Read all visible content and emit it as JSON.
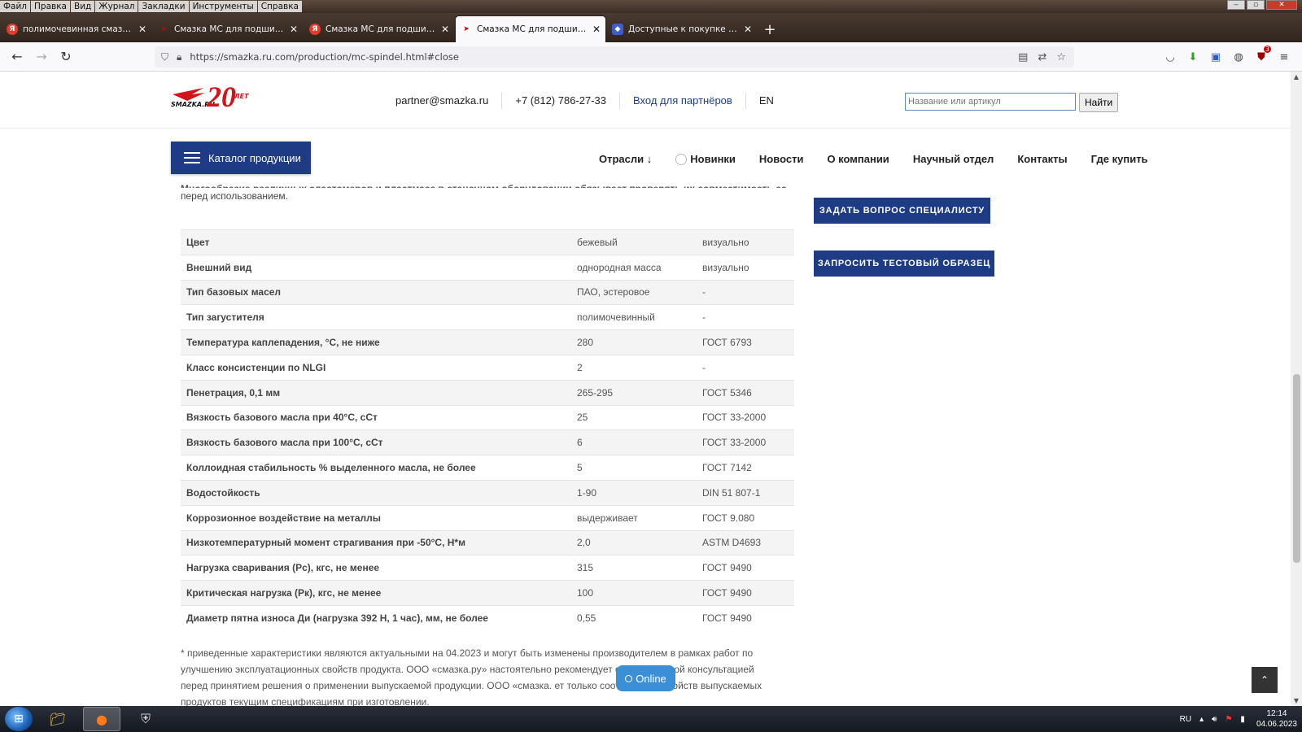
{
  "menu": [
    "Файл",
    "Правка",
    "Вид",
    "Журнал",
    "Закладки",
    "Инструменты",
    "Справка"
  ],
  "tabs": [
    {
      "title": "полимочевинная смазка — Я",
      "icon": "ya"
    },
    {
      "title": "Смазка МС для подшипников",
      "icon": "smazka"
    },
    {
      "title": "Смазка МС для подшипников",
      "icon": "ya"
    },
    {
      "title": "Смазка МС для подшипников",
      "icon": "smazka",
      "active": true
    },
    {
      "title": "Доступные к покупке плимоч",
      "icon": "blue"
    }
  ],
  "url": "https://smazka.ru.com/production/mc-spindel.html#close",
  "extensions_badge": "3",
  "header": {
    "logo_text": "SMAZKA.RU",
    "logo_years": "20",
    "logo_let": "ЛЕТ",
    "email": "partner@smazka.ru",
    "phone": "+7 (812) 786-27-33",
    "partner_login": "Вход для партнёров",
    "lang": "EN",
    "search_placeholder": "Название или артикул",
    "search_button": "Найти"
  },
  "catalog_button": "Каталог продукции",
  "nav": [
    "Отрасли ↓",
    "Новинки",
    "Новости",
    "О компании",
    "Научный отдел",
    "Контакты",
    "Где купить"
  ],
  "intro_cut": "Многообразие различных эластомеров и пластмасс в станочном оборудовании обязывает проверять их совместимость со смазкой",
  "intro_tail": "перед использованием.",
  "specs": [
    [
      "Цвет",
      "бежевый",
      "визуально"
    ],
    [
      "Внешний вид",
      "однородная масса",
      "визуально"
    ],
    [
      "Тип базовых масел",
      "ПАО, эстеровое",
      "-"
    ],
    [
      "Тип загустителя",
      "полимочевинный",
      "-"
    ],
    [
      "Температура каплепадения, °С, не ниже",
      "280",
      "ГОСТ 6793"
    ],
    [
      "Класс консистенции по NLGI",
      "2",
      "-"
    ],
    [
      "Пенетрация, 0,1 мм",
      "265-295",
      "ГОСТ 5346"
    ],
    [
      "Вязкость базового масла при 40°С, сСт",
      "25",
      "ГОСТ 33-2000"
    ],
    [
      "Вязкость базового масла при 100°С, сСт",
      "6",
      "ГОСТ 33-2000"
    ],
    [
      "Коллоидная стабильность % выделенного масла, не более",
      "5",
      "ГОСТ 7142"
    ],
    [
      "Водостойкость",
      "1-90",
      "DIN 51 807-1"
    ],
    [
      "Коррозионное воздействие на металлы",
      "выдерживает",
      "ГОСТ 9.080"
    ],
    [
      "Низкотемпературный момент страгивания при -50°С, Н*м",
      "2,0",
      "ASTM D4693"
    ],
    [
      "Нагрузка сваривания (Рс), кгс, не менее",
      "315",
      "ГОСТ 9490"
    ],
    [
      "Критическая нагрузка (Рк), кгс, не менее",
      "100",
      "ГОСТ 9490"
    ],
    [
      "Диаметр пятна износа Ди (нагрузка 392 Н, 1 час), мм, не более",
      "0,55",
      "ГОСТ 9490"
    ]
  ],
  "footnote": "* приведенные характеристики являются актуальными на 04.2023 и могут быть изменены производителем в рамках работ по улучшению эксплуатационных свойств продукта. ООО «смазка.ру» настоятельно рекомендует об          технической консультацией перед принятием решения о применении выпускаемой продукции. ООО «смазка.          ет только соответствие свойств выпускаемых продуктов текущим спецификациям при изготовлении.",
  "ask_button": "ЗАДАТЬ ВОПРОС СПЕЦИАЛИСТУ",
  "sample_button": "ЗАПРОСИТЬ ТЕСТОВЫЙ ОБРАЗЕЦ",
  "online_label": "Online",
  "taskbar": {
    "lang": "RU",
    "time": "12:14",
    "date": "04.06.2023"
  },
  "colors": {
    "brand_blue": "#1e3c86",
    "online_blue": "#3a8fd6",
    "logo_red": "#d4141b"
  }
}
